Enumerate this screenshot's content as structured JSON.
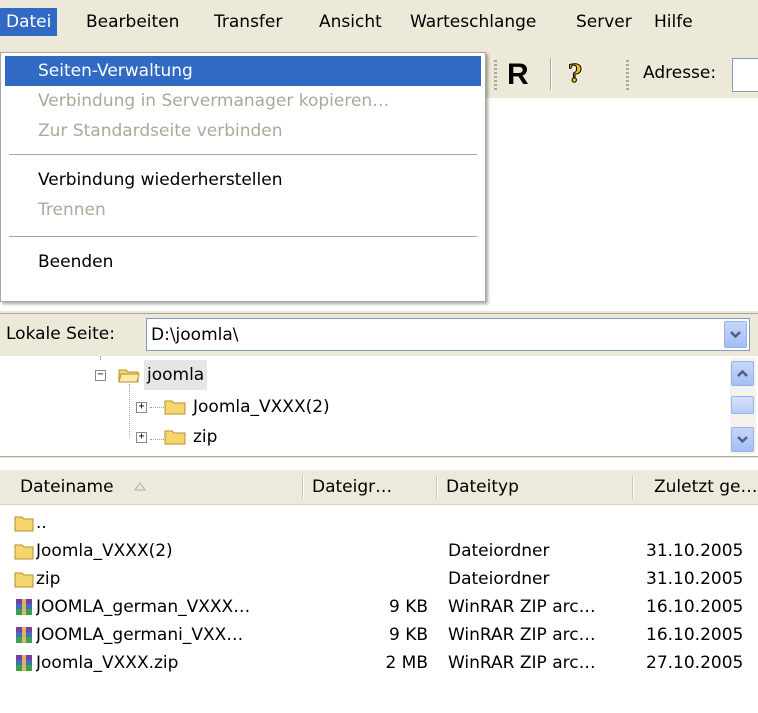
{
  "menubar": {
    "items": [
      {
        "label": "Datei",
        "active": true
      },
      {
        "label": "Bearbeiten"
      },
      {
        "label": "Transfer"
      },
      {
        "label": "Ansicht"
      },
      {
        "label": "Warteschlange"
      },
      {
        "label": "Server"
      },
      {
        "label": "Hilfe"
      }
    ]
  },
  "file_menu": {
    "items": [
      {
        "label": "Seiten-Verwaltung",
        "highlighted": true,
        "enabled": true
      },
      {
        "label": "Verbindung in Servermanager kopieren…",
        "enabled": false
      },
      {
        "label": "Zur Standardseite verbinden",
        "enabled": false
      },
      {
        "label": "Verbindung wiederherstellen",
        "enabled": true
      },
      {
        "label": "Trennen",
        "enabled": false
      },
      {
        "label": "Beenden",
        "enabled": true
      }
    ]
  },
  "toolbar": {
    "reconnect_label": "R",
    "help_icon": "help-icon",
    "address_label": "Adresse:",
    "address_value": ""
  },
  "local_site": {
    "label": "Lokale Seite:",
    "path": "D:\\joomla\\"
  },
  "tree": {
    "nodes": [
      {
        "label": "joomla",
        "selected": true,
        "expanded": true
      },
      {
        "label": "Joomla_VXXX(2)",
        "expanded": false
      },
      {
        "label": "zip",
        "expanded": false
      }
    ]
  },
  "file_list": {
    "columns": [
      "Dateiname",
      "Dateigr…",
      "Dateityp",
      "Zuletzt ge…"
    ],
    "rows": [
      {
        "name": "..",
        "size": "",
        "type": "",
        "modified": "",
        "icon": "folder-icon"
      },
      {
        "name": "Joomla_VXXX(2)",
        "size": "",
        "type": "Dateiordner",
        "modified": "31.10.2005",
        "icon": "folder-icon"
      },
      {
        "name": "zip",
        "size": "",
        "type": "Dateiordner",
        "modified": "31.10.2005",
        "icon": "folder-icon"
      },
      {
        "name": "JOOMLA_german_VXXX…",
        "size": "9 KB",
        "type": "WinRAR ZIP arc…",
        "modified": "16.10.2005",
        "icon": "winrar-archive-icon"
      },
      {
        "name": "JOOMLA_germani_VXX…",
        "size": "9 KB",
        "type": "WinRAR ZIP arc…",
        "modified": "16.10.2005",
        "icon": "winrar-archive-icon"
      },
      {
        "name": "Joomla_VXXX.zip",
        "size": "2 MB",
        "type": "WinRAR ZIP arc…",
        "modified": "27.10.2005",
        "icon": "winrar-archive-icon"
      }
    ]
  },
  "colors": {
    "highlight": "#316ac5",
    "disabled_text": "#aca899",
    "window_bg": "#ece9d8"
  }
}
